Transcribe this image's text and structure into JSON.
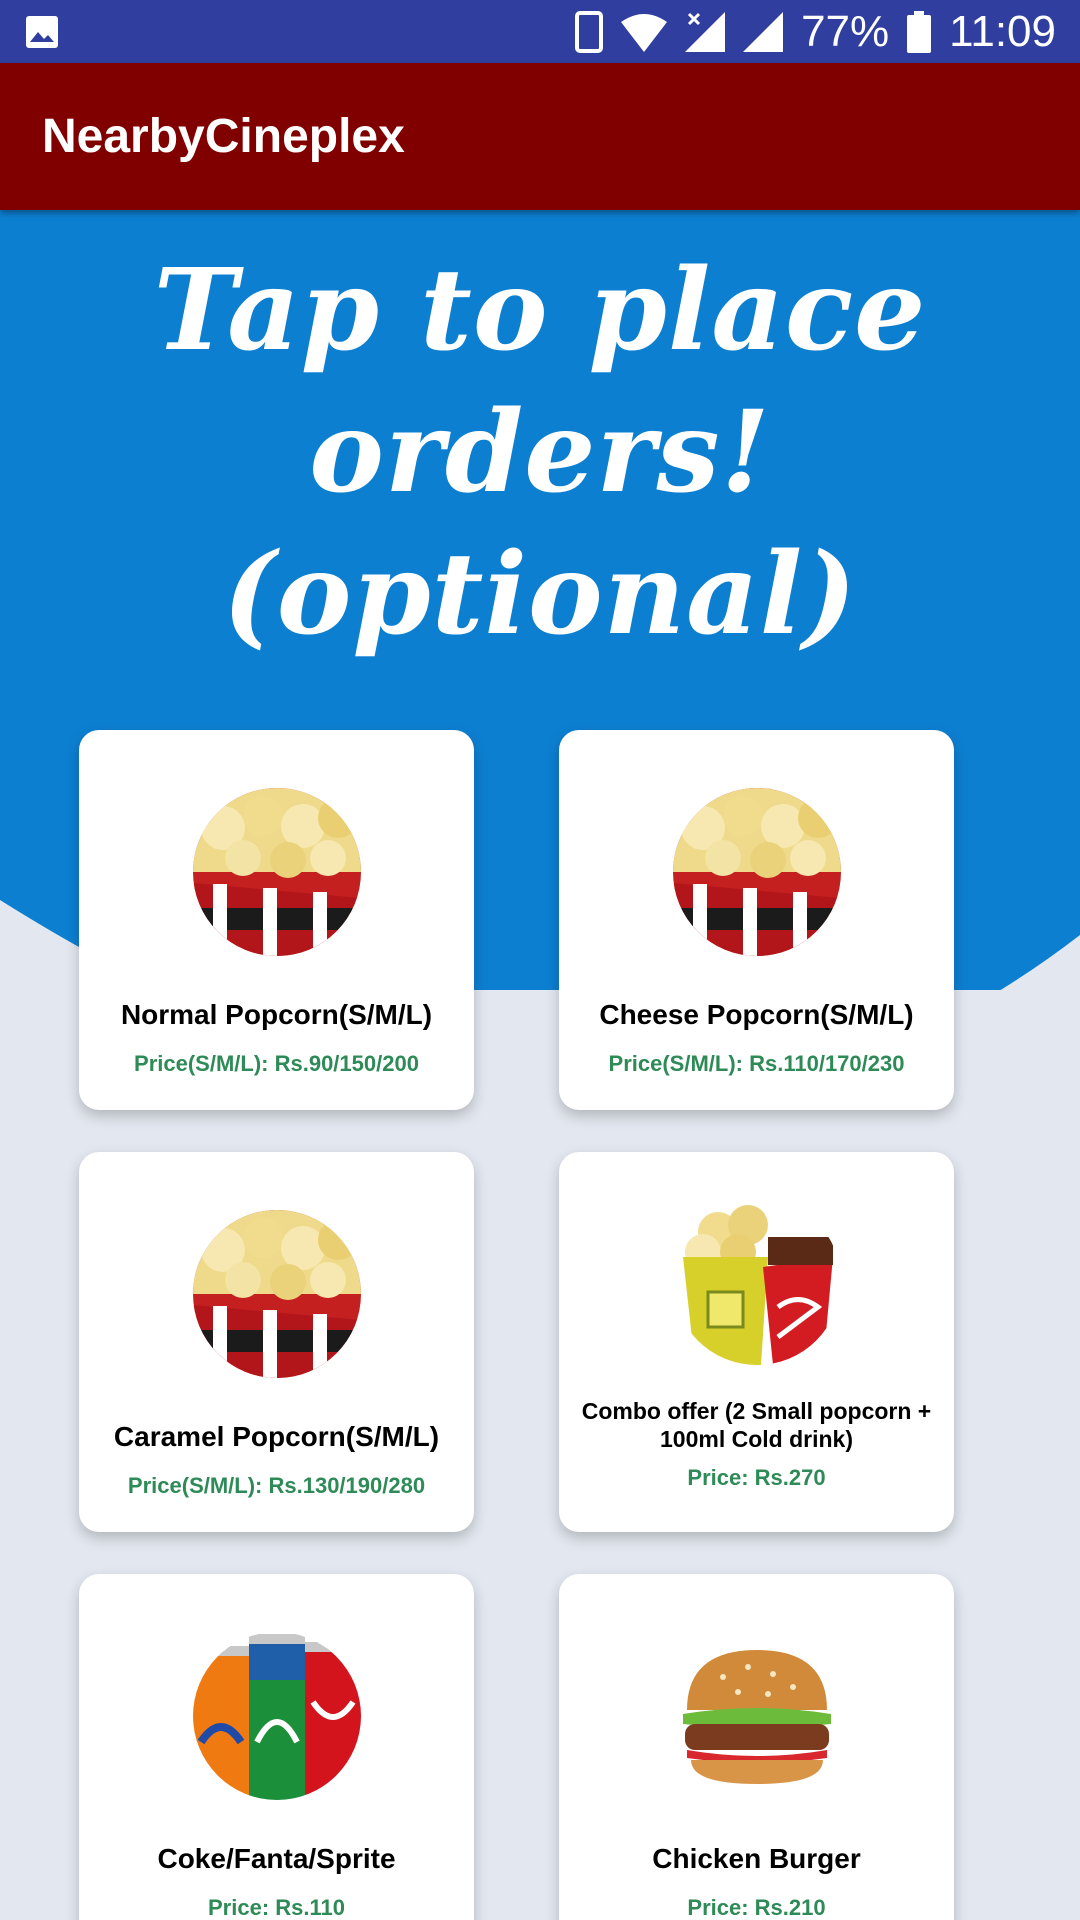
{
  "status_bar": {
    "battery_percent": "77%",
    "time": "11:09",
    "icons": [
      "image-notification-icon",
      "phone-vibrate-icon",
      "wifi-icon",
      "signal-no-data-icon",
      "signal-icon",
      "battery-icon"
    ]
  },
  "app_bar": {
    "title": "NearbyCineplex"
  },
  "hero": {
    "line1": "Tap to place orders!",
    "line2": "(optional)"
  },
  "colors": {
    "status_bar": "#303f9f",
    "app_bar": "#800000",
    "hero_blue": "#0d7fd1",
    "page_bg": "#e3e8f0",
    "price_green": "#2e8b57"
  },
  "items": [
    {
      "name": "Normal Popcorn(S/M/L)",
      "price": "Price(S/M/L): Rs.90/150/200",
      "image": "popcorn-image"
    },
    {
      "name": "Cheese Popcorn(S/M/L)",
      "price": "Price(S/M/L): Rs.110/170/230",
      "image": "popcorn-image"
    },
    {
      "name": "Caramel Popcorn(S/M/L)",
      "price": "Price(S/M/L): Rs.130/190/280",
      "image": "popcorn-image"
    },
    {
      "name": "Combo offer (2 Small popcorn + 100ml Cold drink)",
      "price": "Price: Rs.270",
      "image": "combo-image"
    },
    {
      "name": "Coke/Fanta/Sprite",
      "price": "Price: Rs.110",
      "image": "soda-cans-image"
    },
    {
      "name": "Chicken Burger",
      "price": "Price: Rs.210",
      "image": "burger-image"
    }
  ]
}
